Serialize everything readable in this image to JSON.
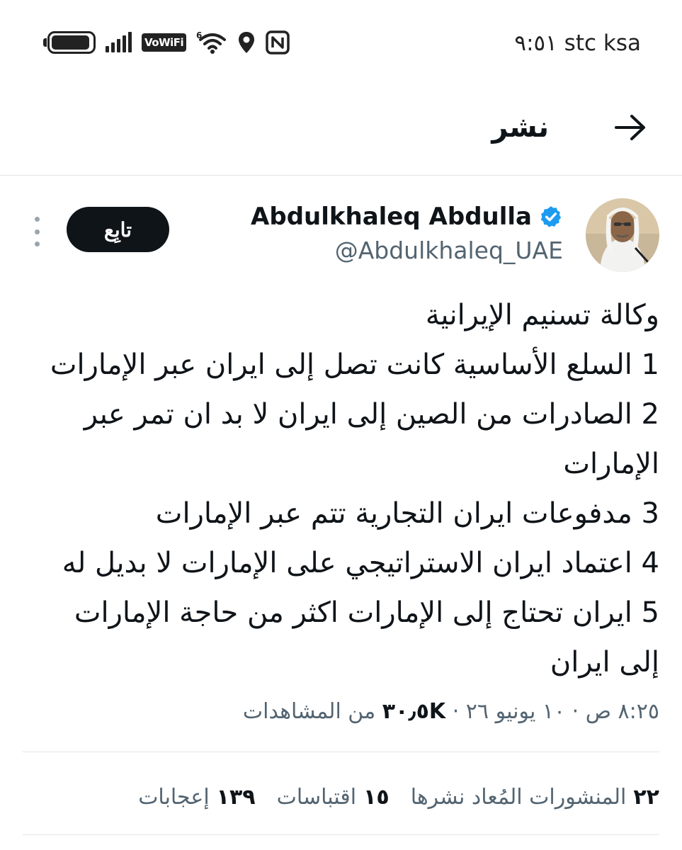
{
  "status_bar": {
    "time_carrier": "٩:٥١ stc ksa",
    "vowifi_label": "VoWiFi",
    "wifi_superscript": "6",
    "battery_level": 0.95
  },
  "header": {
    "title": "نشر"
  },
  "author": {
    "name": "Abdulkhaleq Abdulla",
    "handle": "@Abdulkhaleq_UAE",
    "verified": true,
    "follow_label": "تابِع"
  },
  "tweet": {
    "lines": [
      "وكالة تسنيم الإيرانية",
      "1 السلع الأساسية كانت تصل إلى ايران عبر الإمارات",
      "2 الصادرات من الصين إلى ايران لا بد ان تمر عبر الإمارات",
      "3 مدفوعات ايران التجارية تتم عبر الإمارات",
      "4 اعتماد ايران الاستراتيجي على الإمارات لا بديل له",
      "5 ايران تحتاج إلى الإمارات اكثر من حاجة الإمارات إلى ايران"
    ]
  },
  "meta": {
    "time": "٨:٢٥ ص",
    "date": "١٠ يونيو ٢٦",
    "views_count": "٣٠٫٥K",
    "views_label": "من المشاهدات",
    "separator": "·"
  },
  "stats": [
    {
      "count": "٢٢",
      "label": "المنشورات المُعاد نشرها"
    },
    {
      "count": "١٥",
      "label": "اقتباسات"
    },
    {
      "count": "١٣٩",
      "label": "إعجابات"
    }
  ],
  "colors": {
    "text_primary": "#0f1419",
    "text_secondary": "#536471",
    "verified_blue": "#1d9bf0",
    "divider": "#e1e4e8"
  }
}
